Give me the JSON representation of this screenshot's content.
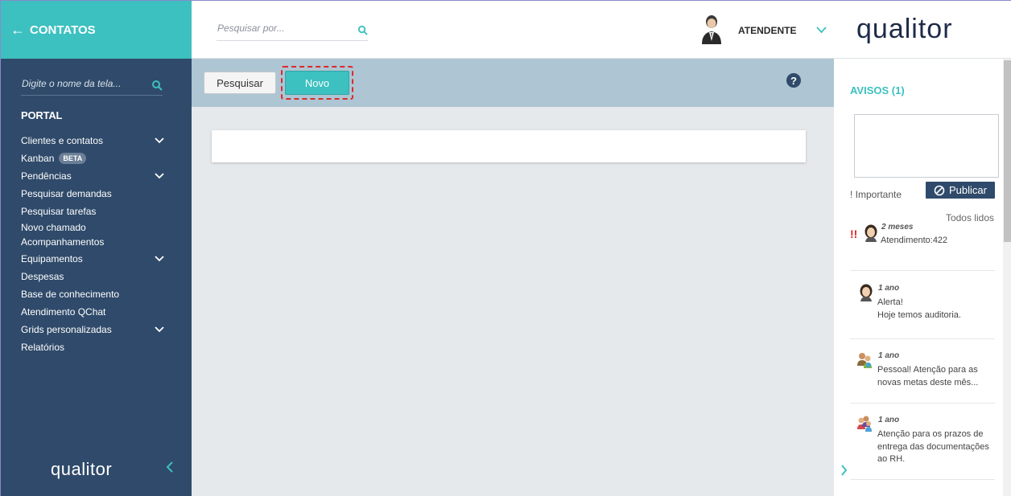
{
  "sidebar": {
    "title": "CONTATOS",
    "back_icon": "arrow-left-icon",
    "search_placeholder": "Digite o nome da tela...",
    "section": "PORTAL",
    "items": [
      {
        "label": "Clientes e contatos",
        "expandable": true
      },
      {
        "label": "Kanban",
        "badge": "BETA"
      },
      {
        "label": "Pendências",
        "expandable": true
      },
      {
        "label": "Pesquisar demandas"
      },
      {
        "label": "Pesquisar tarefas"
      },
      {
        "label": "Novo chamado"
      },
      {
        "label": "Acompanhamentos"
      },
      {
        "label": "Equipamentos",
        "expandable": true
      },
      {
        "label": "Despesas"
      },
      {
        "label": "Base de conhecimento"
      },
      {
        "label": "Atendimento QChat"
      },
      {
        "label": "Grids personalizadas",
        "expandable": true
      },
      {
        "label": "Relatórios"
      }
    ],
    "logo": "qualitor"
  },
  "topbar": {
    "search_placeholder": "Pesquisar por...",
    "user_name": "ATENDENTE",
    "logo": "qualitor"
  },
  "toolbar": {
    "search_label": "Pesquisar",
    "new_label": "Novo",
    "help_label": "?"
  },
  "notices": {
    "title": "AVISOS (1)",
    "important_label": "! Importante",
    "publish_label": "Publicar",
    "all_read_label": "Todos lidos",
    "items": [
      {
        "urgent": "!!",
        "time": "2 meses",
        "lines": [
          "Atendimento:422"
        ]
      },
      {
        "time": "1 ano",
        "lines": [
          "Alerta!",
          "Hoje temos auditoria."
        ]
      },
      {
        "time": "1 ano",
        "lines": [
          "Pessoal! Atenção para as",
          "novas metas deste mês..."
        ]
      },
      {
        "time": "1 ano",
        "lines": [
          "Atenção para os prazos de",
          "entrega das documentações",
          "ao RH."
        ]
      }
    ]
  },
  "colors": {
    "teal": "#3dc0c0",
    "navy": "#2f4a6a",
    "toolbar": "#aec5d3",
    "content_bg": "#e5e9ec",
    "highlight": "#d92b2b"
  }
}
